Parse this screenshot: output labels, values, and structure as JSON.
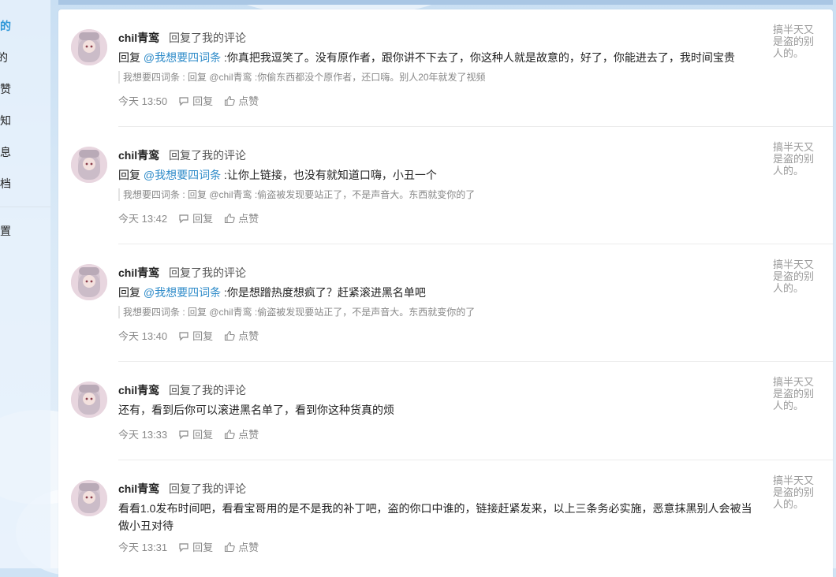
{
  "sidebar": {
    "items": [
      {
        "label": "我的",
        "active": true
      },
      {
        "label": "的",
        "active": false
      },
      {
        "label": "的赞",
        "active": false
      },
      {
        "label": "通知",
        "active": false
      },
      {
        "label": "消息",
        "active": false
      },
      {
        "label": "存档",
        "active": false
      },
      {
        "label": "设置",
        "active": false
      }
    ]
  },
  "colors": {
    "accent": "#2f98d8",
    "mention": "#2e8bc9",
    "muted": "#888888"
  },
  "replies": [
    {
      "author": "chil青鸾",
      "action": "回复了我的评论",
      "prefix": "回复 ",
      "mention": "@我想要四词条",
      "text": " :你真把我逗笑了。没有原作者，跟你讲不下去了，你这种人就是故意的，好了，你能进去了，我时间宝贵",
      "quote": "我想要四词条 : 回复 @chil青鸾 :你偷东西都没个原作者，还口嗨。别人20年就发了视频",
      "time": "今天 13:50",
      "reply_label": "回复",
      "like_label": "点赞",
      "side_note": "搞半天又是盗的别人的。"
    },
    {
      "author": "chil青鸾",
      "action": "回复了我的评论",
      "prefix": "回复 ",
      "mention": "@我想要四词条",
      "text": " :让你上链接，也没有就知道口嗨，小丑一个",
      "quote": "我想要四词条 : 回复 @chil青鸾 :偷盗被发现要站正了，不是声音大。东西就变你的了",
      "time": "今天 13:42",
      "reply_label": "回复",
      "like_label": "点赞",
      "side_note": "搞半天又是盗的别人的。"
    },
    {
      "author": "chil青鸾",
      "action": "回复了我的评论",
      "prefix": "回复 ",
      "mention": "@我想要四词条",
      "text": " :你是想蹭热度想疯了？赶紧滚进黑名单吧",
      "quote": "我想要四词条 : 回复 @chil青鸾 :偷盗被发现要站正了，不是声音大。东西就变你的了",
      "time": "今天 13:40",
      "reply_label": "回复",
      "like_label": "点赞",
      "side_note": "搞半天又是盗的别人的。"
    },
    {
      "author": "chil青鸾",
      "action": "回复了我的评论",
      "prefix": "",
      "mention": "",
      "text": "还有，看到后你可以滚进黑名单了，看到你这种货真的烦",
      "quote": "",
      "time": "今天 13:33",
      "reply_label": "回复",
      "like_label": "点赞",
      "side_note": "搞半天又是盗的别人的。"
    },
    {
      "author": "chil青鸾",
      "action": "回复了我的评论",
      "prefix": "",
      "mention": "",
      "text": "看看1.0发布时间吧，看看宝哥用的是不是我的补丁吧，盗的你口中谁的，链接赶紧发来，以上三条务必实施，恶意抹黑别人会被当做小丑对待",
      "quote": "",
      "time": "今天 13:31",
      "reply_label": "回复",
      "like_label": "点赞",
      "side_note": "搞半天又是盗的别人的。"
    }
  ]
}
